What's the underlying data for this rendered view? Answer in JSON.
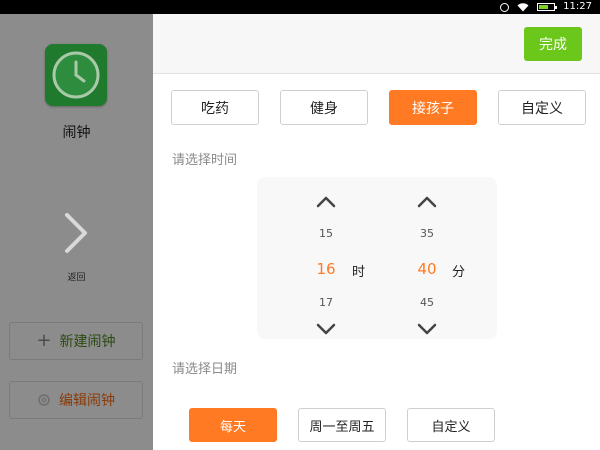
{
  "status_bar": {
    "time": "11:27",
    "icons": [
      "alarm-icon",
      "wifi-icon",
      "battery-icon"
    ]
  },
  "sidebar": {
    "app_name": "闹钟",
    "app_icon": "clock-icon",
    "back_label": "返回",
    "new_alarm_label": "新建闹钟",
    "edit_alarm_label": "编辑闹钟"
  },
  "topbar": {
    "done_label": "完成"
  },
  "alarm_types": [
    {
      "label": "吃药",
      "selected": false
    },
    {
      "label": "健身",
      "selected": false
    },
    {
      "label": "接孩子",
      "selected": true
    },
    {
      "label": "自定义",
      "selected": false
    }
  ],
  "time_section_label": "请选择时间",
  "time_picker": {
    "hour": {
      "prev": "15",
      "selected": "16",
      "next": "17",
      "unit": "时"
    },
    "minute": {
      "prev": "35",
      "selected": "40",
      "next": "45",
      "unit": "分"
    }
  },
  "date_section_label": "请选择日期",
  "repeat_options": [
    {
      "label": "每天",
      "selected": true
    },
    {
      "label": "周一至周五",
      "selected": false
    },
    {
      "label": "自定义",
      "selected": false
    }
  ],
  "colors": {
    "accent": "#ff7a22",
    "done_green": "#6bc81a",
    "sidebar_dim": "#8c8c8c"
  }
}
